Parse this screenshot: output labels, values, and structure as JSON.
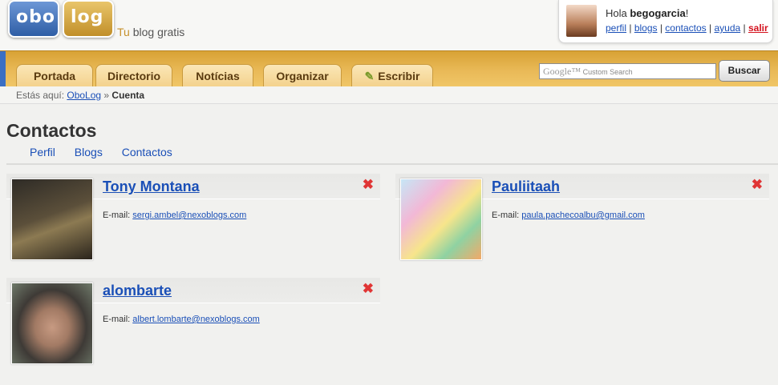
{
  "logo": {
    "part1": "obo",
    "part2": "log"
  },
  "tagline": {
    "tu": "Tu",
    "rest": " blog gratis"
  },
  "user": {
    "greeting": "Hola ",
    "username": "begogarcia",
    "exclaim": "!",
    "links": {
      "perfil": "perfil",
      "blogs": "blogs",
      "contactos": "contactos",
      "ayuda": "ayuda",
      "salir": "salir"
    },
    "sep": " | "
  },
  "nav": {
    "tabs": [
      "Portada",
      "Directorio",
      "Notícias",
      "Organizar",
      "Escribir"
    ],
    "search_placeholder": "Custom Search",
    "search_brand": "Google™",
    "search_button": "Buscar"
  },
  "breadcrumb": {
    "prefix": "Estás aquí: ",
    "link": "OboLog",
    "sep": " » ",
    "current": "Cuenta"
  },
  "page": {
    "title": "Contactos",
    "subnav": [
      "Perfil",
      "Blogs",
      "Contactos"
    ]
  },
  "email_label": "E-mail: ",
  "contacts": [
    {
      "name": "Tony Montana",
      "email": "sergi.ambel@nexoblogs.com"
    },
    {
      "name": "Pauliitaah",
      "email": "paula.pachecoalbu@gmail.com"
    },
    {
      "name": "alombarte",
      "email": "albert.lombarte@nexoblogs.com"
    }
  ],
  "close_glyph": "✖",
  "colors": {
    "link": "#1a4fb7",
    "nav_gold": "#e9b957",
    "close_red": "#e03535",
    "salir_red": "#d4121e"
  }
}
